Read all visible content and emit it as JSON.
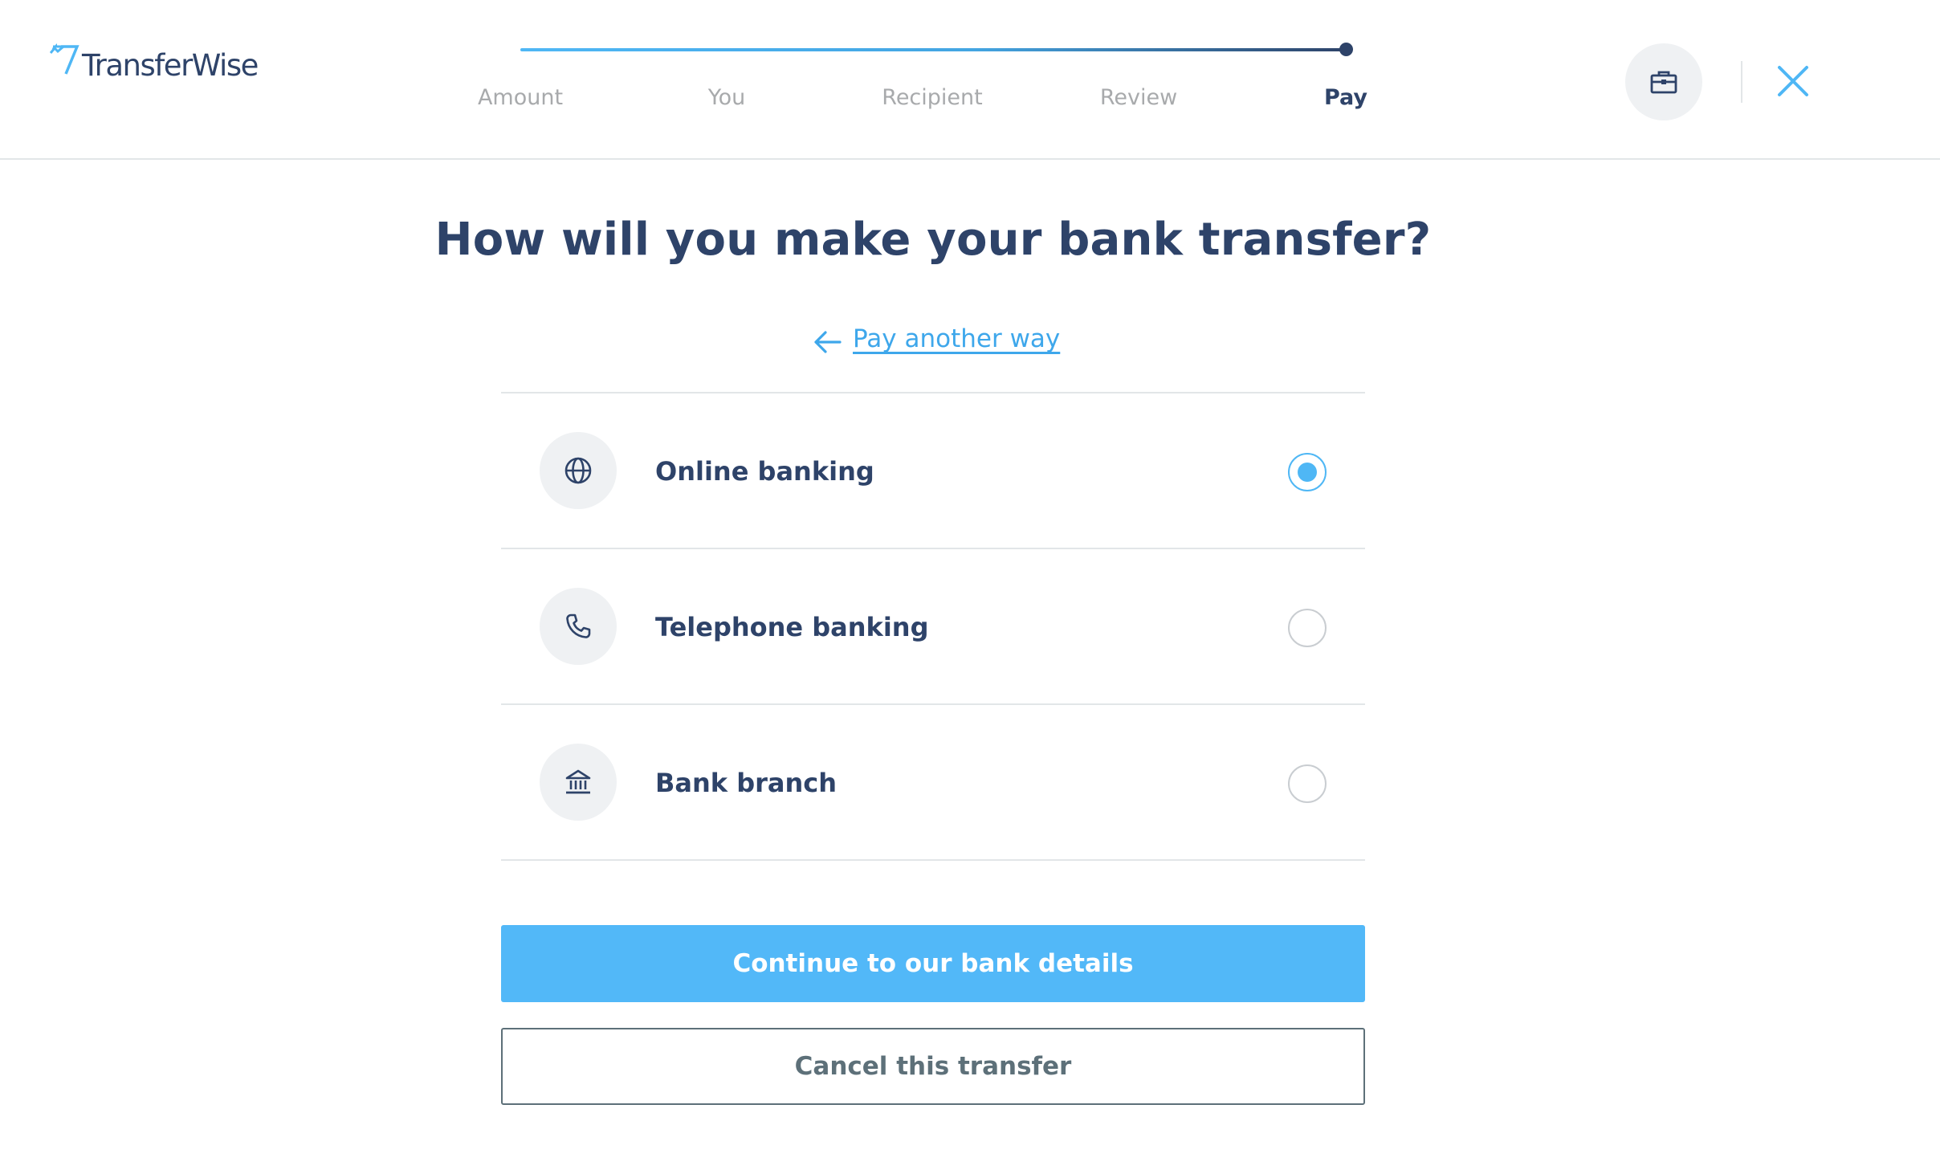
{
  "brand": {
    "name": "TransferWise",
    "logo_icon": "transferwise-flag-icon",
    "accent_color": "#4fb7f5",
    "text_color": "#2e4369"
  },
  "stepper": {
    "steps": [
      {
        "label": "Amount",
        "active": false
      },
      {
        "label": "You",
        "active": false
      },
      {
        "label": "Recipient",
        "active": false
      },
      {
        "label": "Review",
        "active": false
      },
      {
        "label": "Pay",
        "active": true
      }
    ]
  },
  "header": {
    "business_icon": "briefcase-icon",
    "close_icon": "close-icon"
  },
  "main": {
    "title": "How will you make your bank transfer?",
    "back_link": "Pay another way",
    "options": [
      {
        "label": "Online banking",
        "icon": "globe-icon",
        "selected": true
      },
      {
        "label": "Telephone banking",
        "icon": "phone-icon",
        "selected": false
      },
      {
        "label": "Bank branch",
        "icon": "bank-icon",
        "selected": false
      }
    ],
    "continue_button": "Continue to our bank details",
    "cancel_button": "Cancel this transfer"
  }
}
